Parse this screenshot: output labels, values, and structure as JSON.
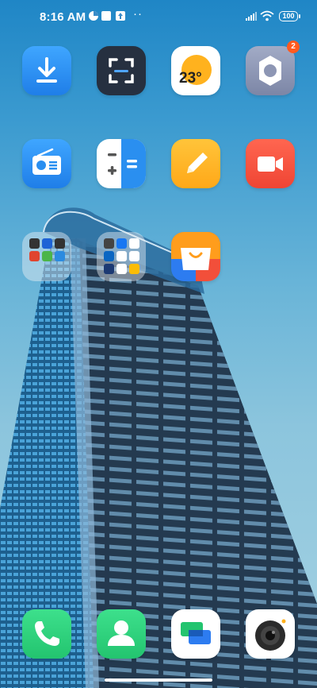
{
  "status_bar": {
    "time": "8:16 AM",
    "battery": "100",
    "icons": [
      "screenshot-status-icon",
      "square-status-icon",
      "upload-status-icon",
      "more-dots-icon",
      "signal-icon",
      "wifi-icon",
      "battery-icon"
    ]
  },
  "apps_row1": [
    {
      "name": "downloads-app",
      "icon": "download-arrow-icon",
      "color": "#2a8ff0"
    },
    {
      "name": "scanner-app",
      "icon": "scan-frame-icon",
      "color": "#2b3342"
    },
    {
      "name": "weather-app",
      "icon": "sun-temperature-icon",
      "label": "23°",
      "color": "#ffffff"
    },
    {
      "name": "settings-app",
      "icon": "gear-icon",
      "color": "#8d96b4",
      "badge": "2"
    }
  ],
  "apps_row2": [
    {
      "name": "fm-radio-app",
      "icon": "radio-icon",
      "color": "#2a8ff0"
    },
    {
      "name": "calculator-app",
      "icon": "calculator-icon",
      "color": "#ffffff"
    },
    {
      "name": "notes-app",
      "icon": "pencil-icon",
      "color": "#ffb321"
    },
    {
      "name": "screen-recorder-app",
      "icon": "video-camera-icon",
      "color": "#f04f3e"
    }
  ],
  "folders": [
    {
      "name": "folder-1",
      "icon": "folder-icon"
    },
    {
      "name": "folder-2",
      "icon": "folder-icon"
    }
  ],
  "store_app": {
    "name": "app-store",
    "icon": "shopping-bag-icon"
  },
  "dock": [
    {
      "name": "phone-app",
      "icon": "phone-icon",
      "color": "#2fd17e"
    },
    {
      "name": "contacts-app",
      "icon": "contact-person-icon",
      "color": "#2fd17e"
    },
    {
      "name": "messages-app",
      "icon": "chat-bubbles-icon",
      "color": "#ffffff"
    },
    {
      "name": "camera-app",
      "icon": "camera-lens-icon",
      "color": "#ffffff"
    }
  ]
}
